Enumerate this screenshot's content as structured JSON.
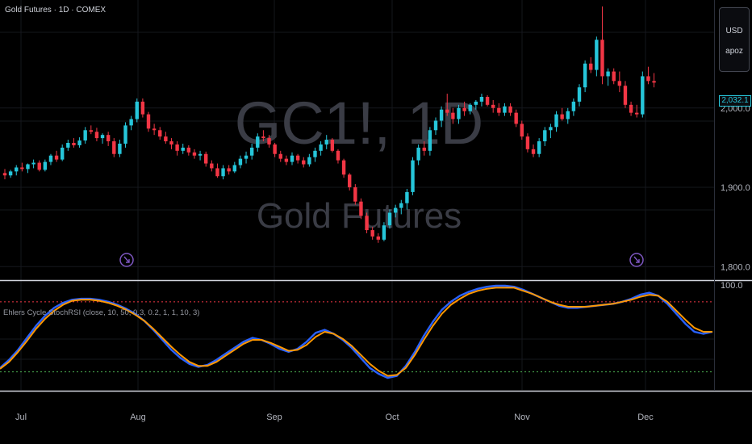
{
  "header": {
    "symbol_title": "Gold Futures · 1D · COMEX"
  },
  "watermark": {
    "ticker": "GC1!, 1D",
    "name": "Gold Futures"
  },
  "price_scale": {
    "currency": "USD",
    "unit": "apoz",
    "last_price": "2,032.1"
  },
  "indicator": {
    "label": "Ehlers Cycle StochRSI (close, 10, 50, 0.3, 0.2, 1, 1, 10, 3)"
  },
  "colors": {
    "up": "#26c6da",
    "down": "#f23645",
    "k_line": "#2962ff",
    "d_line": "#ff9800",
    "upper_band": "#f23645",
    "lower_band": "#4caf50",
    "event_icon": "#7e57c2"
  },
  "chart_data": [
    {
      "type": "candlestick",
      "title": "",
      "x_ticks": [
        "Jul",
        "Aug",
        "Sep",
        "Oct",
        "Nov",
        "Dec"
      ],
      "y_ticks": [
        "2,000.0",
        "1,900.0",
        "1,800.0"
      ],
      "y_tick_values": [
        2000,
        1900,
        1800
      ],
      "ylim": [
        1785,
        2128
      ],
      "grid": true,
      "series": [
        {
          "name": "",
          "ohlc": [
            [
              1918,
              1923,
              1910,
              1915
            ],
            [
              1915,
              1922,
              1912,
              1920
            ],
            [
              1920,
              1928,
              1915,
              1925
            ],
            [
              1925,
              1931,
              1920,
              1923
            ],
            [
              1923,
              1930,
              1918,
              1929
            ],
            [
              1929,
              1935,
              1924,
              1931
            ],
            [
              1931,
              1934,
              1920,
              1922
            ],
            [
              1922,
              1935,
              1920,
              1932
            ],
            [
              1932,
              1942,
              1928,
              1940
            ],
            [
              1940,
              1946,
              1932,
              1935
            ],
            [
              1935,
              1954,
              1933,
              1950
            ],
            [
              1950,
              1960,
              1946,
              1956
            ],
            [
              1956,
              1962,
              1950,
              1953
            ],
            [
              1953,
              1963,
              1950,
              1959
            ],
            [
              1959,
              1976,
              1955,
              1972
            ],
            [
              1972,
              1978,
              1967,
              1970
            ],
            [
              1970,
              1975,
              1958,
              1962
            ],
            [
              1962,
              1968,
              1955,
              1966
            ],
            [
              1966,
              1970,
              1952,
              1958
            ],
            [
              1958,
              1962,
              1938,
              1942
            ],
            [
              1942,
              1960,
              1938,
              1955
            ],
            [
              1955,
              1982,
              1950,
              1978
            ],
            [
              1978,
              1990,
              1972,
              1986
            ],
            [
              1986,
              2012,
              1982,
              2008
            ],
            [
              2008,
              2012,
              1988,
              1992
            ],
            [
              1992,
              1995,
              1970,
              1974
            ],
            [
              1974,
              1980,
              1966,
              1972
            ],
            [
              1972,
              1976,
              1960,
              1964
            ],
            [
              1964,
              1970,
              1955,
              1958
            ],
            [
              1958,
              1962,
              1948,
              1954
            ],
            [
              1954,
              1958,
              1940,
              1946
            ],
            [
              1946,
              1955,
              1942,
              1950
            ],
            [
              1950,
              1953,
              1940,
              1944
            ],
            [
              1944,
              1948,
              1936,
              1940
            ],
            [
              1940,
              1946,
              1934,
              1942
            ],
            [
              1942,
              1945,
              1926,
              1930
            ],
            [
              1930,
              1934,
              1920,
              1924
            ],
            [
              1924,
              1930,
              1912,
              1914
            ],
            [
              1914,
              1928,
              1910,
              1924
            ],
            [
              1924,
              1928,
              1916,
              1920
            ],
            [
              1920,
              1932,
              1918,
              1928
            ],
            [
              1928,
              1940,
              1924,
              1936
            ],
            [
              1936,
              1945,
              1930,
              1940
            ],
            [
              1940,
              1955,
              1935,
              1950
            ],
            [
              1950,
              1968,
              1945,
              1964
            ],
            [
              1964,
              1972,
              1958,
              1962
            ],
            [
              1962,
              1966,
              1950,
              1954
            ],
            [
              1954,
              1956,
              1938,
              1942
            ],
            [
              1942,
              1946,
              1932,
              1936
            ],
            [
              1936,
              1940,
              1928,
              1932
            ],
            [
              1932,
              1944,
              1928,
              1940
            ],
            [
              1940,
              1942,
              1930,
              1934
            ],
            [
              1934,
              1938,
              1925,
              1929
            ],
            [
              1929,
              1942,
              1926,
              1938
            ],
            [
              1938,
              1950,
              1932,
              1946
            ],
            [
              1946,
              1958,
              1940,
              1954
            ],
            [
              1954,
              1966,
              1948,
              1960
            ],
            [
              1960,
              1962,
              1944,
              1946
            ],
            [
              1946,
              1948,
              1930,
              1934
            ],
            [
              1934,
              1936,
              1912,
              1916
            ],
            [
              1916,
              1918,
              1896,
              1900
            ],
            [
              1900,
              1904,
              1878,
              1882
            ],
            [
              1882,
              1886,
              1860,
              1864
            ],
            [
              1864,
              1868,
              1842,
              1846
            ],
            [
              1846,
              1850,
              1834,
              1838
            ],
            [
              1838,
              1842,
              1830,
              1834
            ],
            [
              1834,
              1856,
              1832,
              1852
            ],
            [
              1852,
              1872,
              1848,
              1868
            ],
            [
              1868,
              1878,
              1862,
              1874
            ],
            [
              1874,
              1884,
              1866,
              1880
            ],
            [
              1880,
              1898,
              1872,
              1894
            ],
            [
              1894,
              1938,
              1890,
              1934
            ],
            [
              1934,
              1954,
              1928,
              1950
            ],
            [
              1950,
              1958,
              1940,
              1946
            ],
            [
              1946,
              1976,
              1940,
              1972
            ],
            [
              1972,
              1988,
              1966,
              1984
            ],
            [
              1984,
              2002,
              1976,
              1998
            ],
            [
              1998,
              2018,
              1990,
              1994
            ],
            [
              1994,
              2000,
              1980,
              1986
            ],
            [
              1986,
              2004,
              1980,
              2000
            ],
            [
              2000,
              2008,
              1990,
              1996
            ],
            [
              1996,
              2006,
              1992,
              2004
            ],
            [
              2004,
              2010,
              1998,
              2008
            ],
            [
              2008,
              2018,
              2002,
              2014
            ],
            [
              2014,
              2016,
              2002,
              2004
            ],
            [
              2004,
              2010,
              1994,
              2000
            ],
            [
              2000,
              2006,
              1990,
              1994
            ],
            [
              1994,
              2006,
              1990,
              2002
            ],
            [
              2002,
              2006,
              1990,
              1994
            ],
            [
              1994,
              1998,
              1976,
              1980
            ],
            [
              1980,
              1984,
              1960,
              1964
            ],
            [
              1964,
              1968,
              1944,
              1948
            ],
            [
              1948,
              1954,
              1938,
              1942
            ],
            [
              1942,
              1962,
              1938,
              1958
            ],
            [
              1958,
              1976,
              1952,
              1972
            ],
            [
              1972,
              1980,
              1962,
              1976
            ],
            [
              1976,
              1996,
              1970,
              1992
            ],
            [
              1992,
              2000,
              1984,
              1986
            ],
            [
              1986,
              2000,
              1980,
              1996
            ],
            [
              1996,
              2012,
              1990,
              2008
            ],
            [
              2008,
              2030,
              2002,
              2026
            ],
            [
              2026,
              2060,
              2020,
              2056
            ],
            [
              2056,
              2064,
              2044,
              2048
            ],
            [
              2048,
              2090,
              2040,
              2086
            ],
            [
              2086,
              2128,
              2030,
              2040
            ],
            [
              2040,
              2050,
              2028,
              2046
            ],
            [
              2046,
              2050,
              2030,
              2034
            ],
            [
              2034,
              2046,
              2020,
              2028
            ],
            [
              2028,
              2034,
              2000,
              2004
            ],
            [
              2004,
              2008,
              1990,
              1994
            ],
            [
              1994,
              2004,
              1988,
              1992
            ],
            [
              1992,
              2046,
              1988,
              2040
            ],
            [
              2040,
              2052,
              2030,
              2034
            ],
            [
              2034,
              2044,
              2026,
              2032
            ]
          ]
        }
      ],
      "event_markers": [
        {
          "month": "Aug",
          "icon": "arrow-circle-icon"
        },
        {
          "month": "Dec",
          "icon": "arrow-circle-icon"
        }
      ]
    },
    {
      "type": "line",
      "title": "Ehlers Cycle StochRSI (close, 10, 50, 0.3, 0.2, 1, 1, 10, 3)",
      "y_ticks": [
        "100.0"
      ],
      "y_tick_values": [
        100
      ],
      "ylim": [
        -8,
        100
      ],
      "bands": {
        "upper": 80,
        "lower": 10
      },
      "series": [
        {
          "name": "",
          "color": "#2962ff",
          "values": [
            14,
            22,
            32,
            44,
            56,
            66,
            74,
            79,
            82,
            83,
            83,
            82,
            80,
            77,
            73,
            68,
            61,
            52,
            42,
            32,
            24,
            18,
            15,
            17,
            22,
            28,
            34,
            40,
            44,
            42,
            38,
            33,
            30,
            33,
            40,
            49,
            52,
            48,
            42,
            34,
            24,
            14,
            8,
            4,
            6,
            16,
            30,
            46,
            60,
            72,
            80,
            86,
            90,
            93,
            95,
            96,
            96,
            95,
            92,
            88,
            84,
            80,
            76,
            74,
            74,
            75,
            76,
            77,
            78,
            80,
            83,
            87,
            89,
            86,
            78,
            68,
            58,
            50,
            48,
            50
          ]
        },
        {
          "name": "",
          "color": "#ff9800",
          "values": [
            13,
            20,
            30,
            41,
            53,
            63,
            71,
            77,
            81,
            82,
            82,
            81,
            79,
            76,
            72,
            67,
            61,
            53,
            44,
            35,
            27,
            20,
            16,
            16,
            20,
            26,
            32,
            38,
            42,
            42,
            39,
            35,
            31,
            32,
            37,
            45,
            50,
            48,
            43,
            36,
            27,
            18,
            11,
            6,
            7,
            14,
            27,
            42,
            56,
            68,
            77,
            83,
            88,
            91,
            93,
            94,
            94,
            94,
            91,
            88,
            84,
            80,
            77,
            75,
            75,
            75,
            76,
            77,
            78,
            80,
            82,
            85,
            87,
            86,
            80,
            71,
            62,
            54,
            50,
            50
          ]
        }
      ]
    }
  ]
}
